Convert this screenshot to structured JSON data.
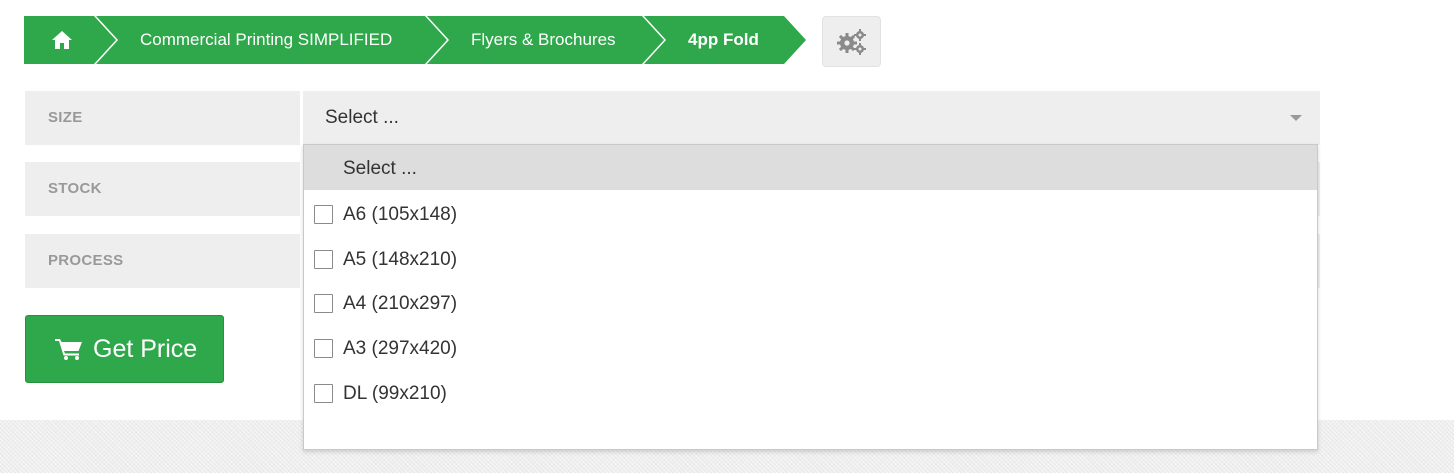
{
  "breadcrumb": {
    "home_icon": "home-icon",
    "items": [
      {
        "label": "Commercial Printing SIMPLIFIED"
      },
      {
        "label": "Flyers & Brochures"
      },
      {
        "label": "4pp Fold"
      }
    ]
  },
  "settings": {
    "icon": "gears-icon"
  },
  "form": {
    "size": {
      "label": "SIZE",
      "value": "Select ..."
    },
    "stock": {
      "label": "STOCK"
    },
    "process": {
      "label": "PROCESS"
    }
  },
  "dropdown": {
    "header": "Select ...",
    "options": [
      {
        "label": "A6 (105x148)",
        "checked": false
      },
      {
        "label": "A5 (148x210)",
        "checked": false
      },
      {
        "label": "A4 (210x297)",
        "checked": false
      },
      {
        "label": "A3 (297x420)",
        "checked": false
      },
      {
        "label": "DL (99x210)",
        "checked": false
      }
    ]
  },
  "get_price": {
    "label": "Get Price",
    "icon": "shopping-cart-icon"
  },
  "colors": {
    "accent": "#2ea84a",
    "field_bg": "#eeeeee",
    "label_text": "#999999"
  }
}
